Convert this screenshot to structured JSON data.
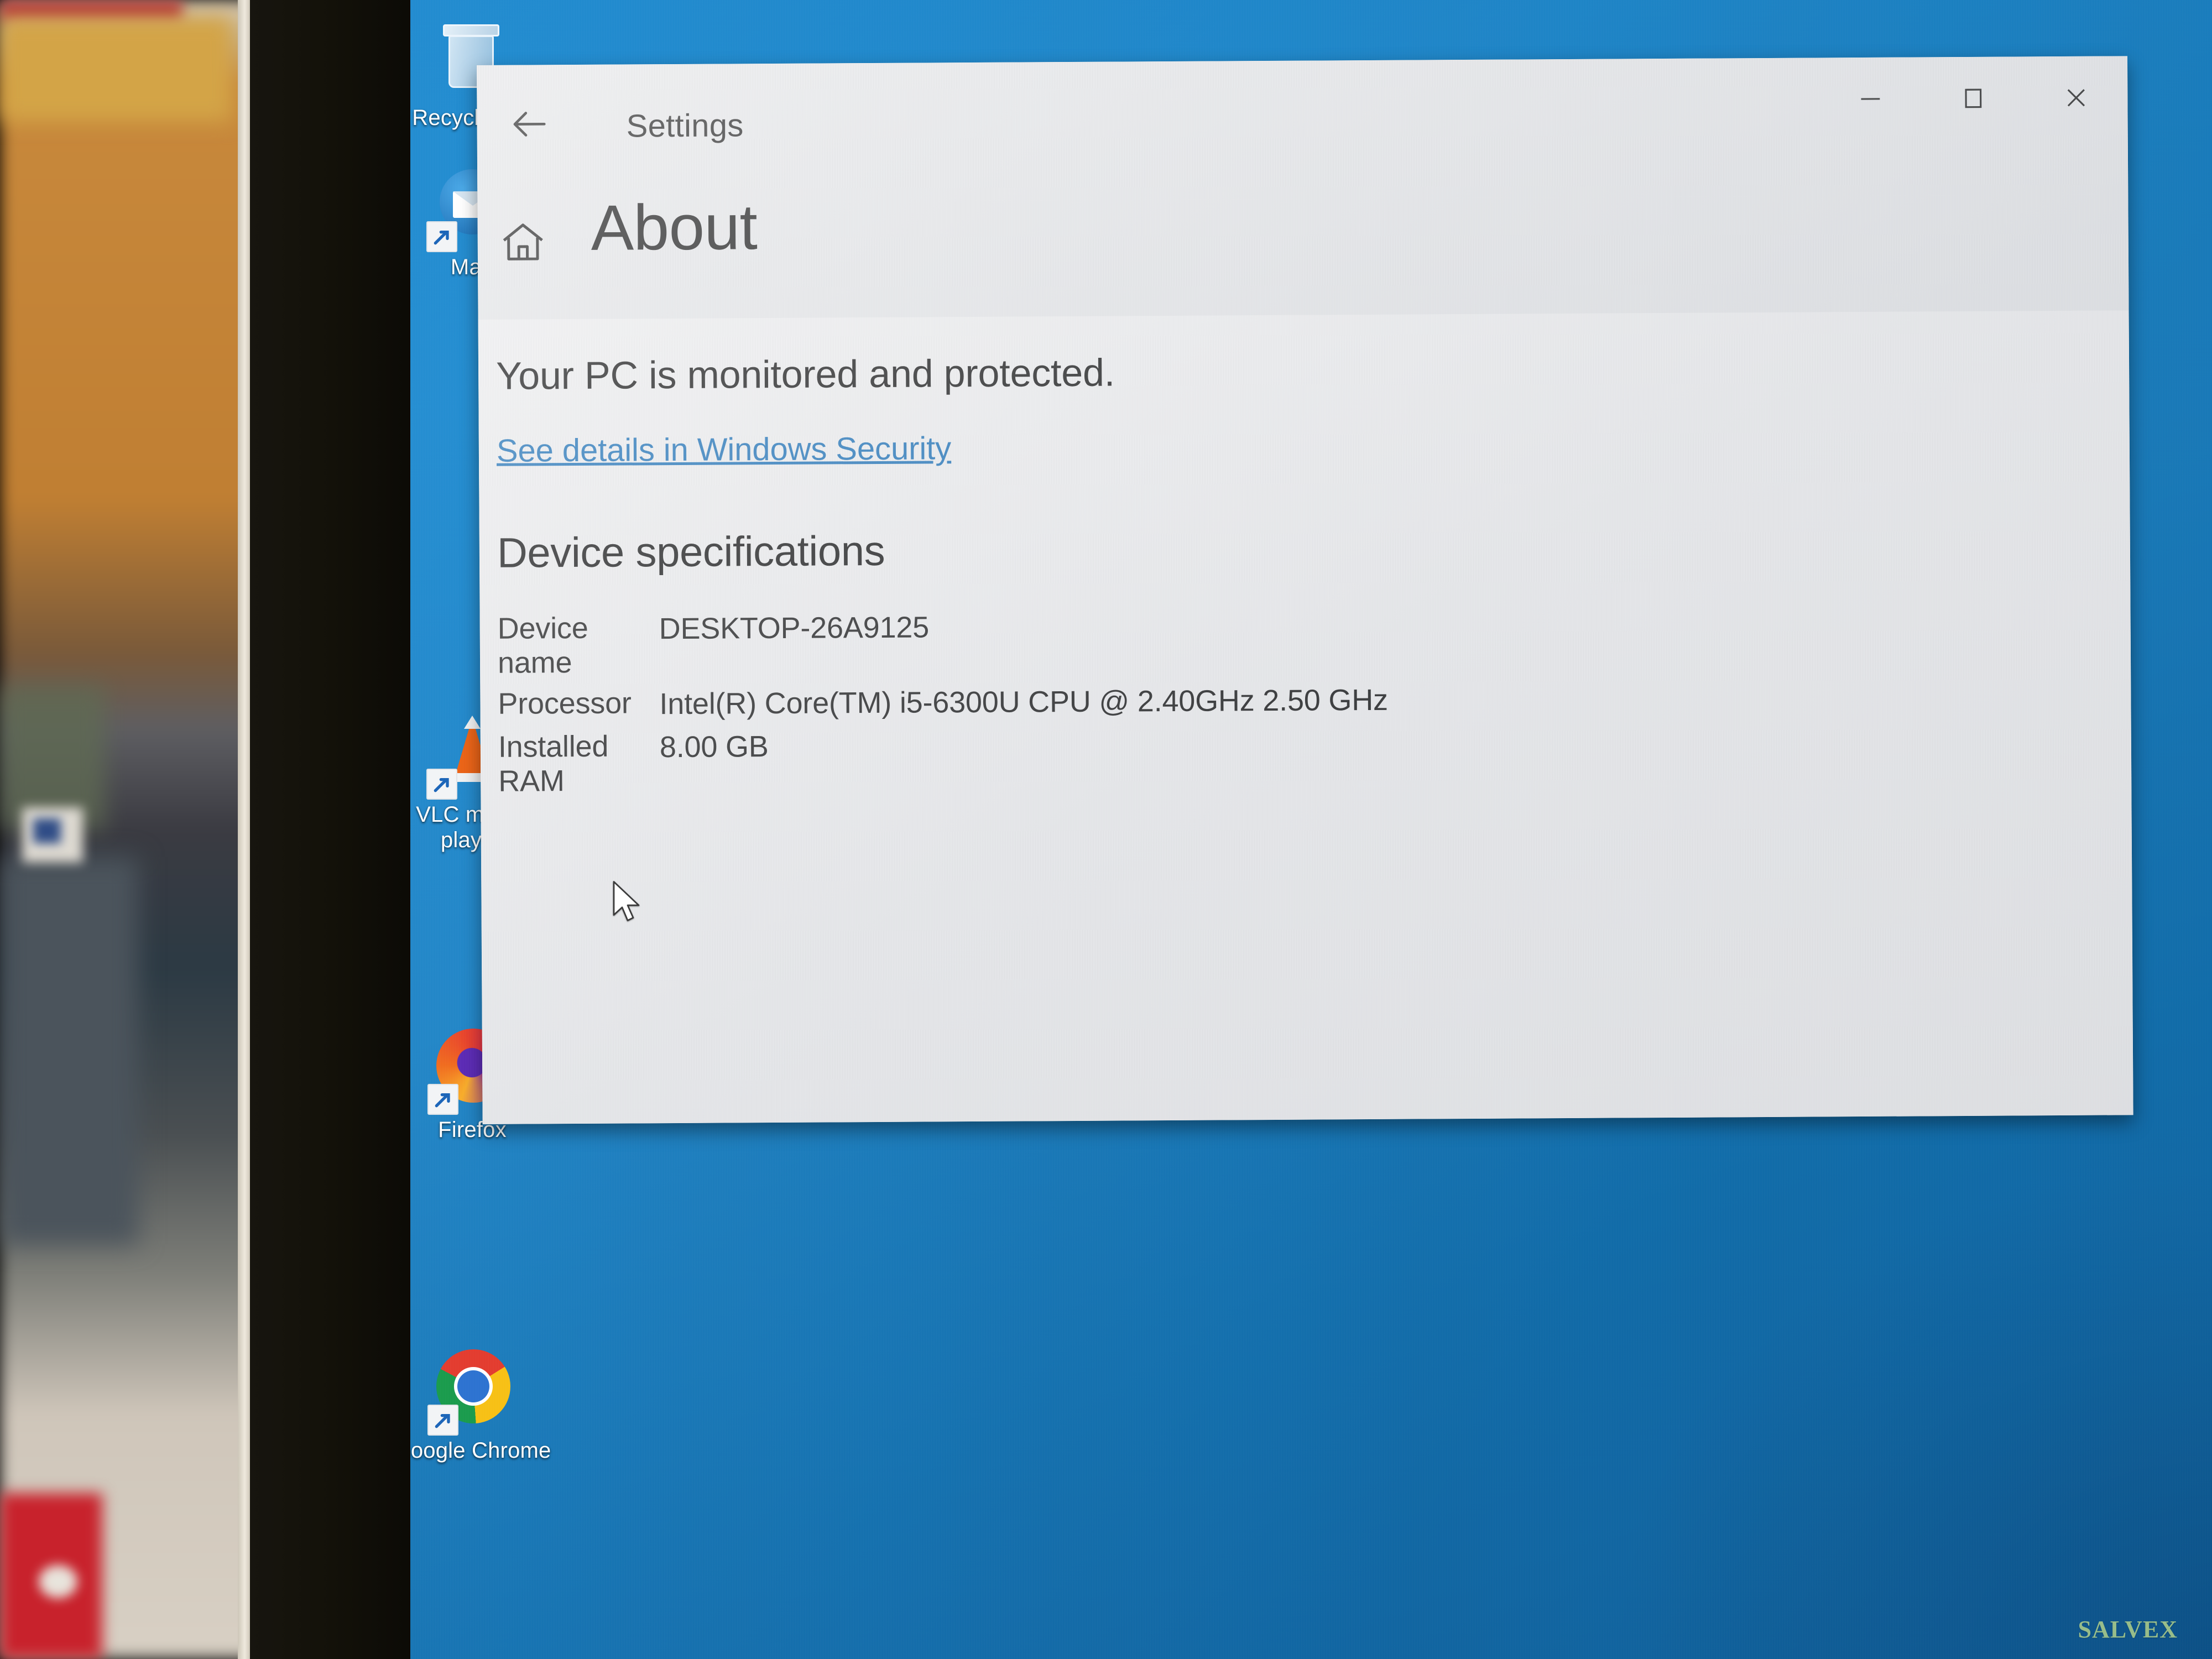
{
  "window": {
    "title": "Settings",
    "back_icon": "back-arrow-icon",
    "minimize_icon": "minimize-icon",
    "maximize_icon": "maximize-icon",
    "close_icon": "close-icon"
  },
  "page": {
    "home_icon": "home-icon",
    "title": "About",
    "status_text": "Your PC is monitored and protected.",
    "security_link": "See details in Windows Security",
    "section_heading": "Device specifications",
    "specs": [
      {
        "key": "Device name",
        "value": "DESKTOP-26A9125"
      },
      {
        "key": "Processor",
        "value": "Intel(R) Core(TM) i5-6300U CPU @ 2.40GHz   2.50 GHz"
      },
      {
        "key": "Installed RAM",
        "value": "8.00 GB"
      }
    ]
  },
  "desktop": {
    "icons": [
      {
        "name": "Recycle Bin",
        "icon": "recycle-bin-icon"
      },
      {
        "name": "Mail",
        "icon": "mail-icon"
      },
      {
        "name": "VLC media player",
        "icon": "vlc-cone-icon"
      },
      {
        "name": "Firefox",
        "icon": "firefox-icon"
      },
      {
        "name": "Google Chrome",
        "icon": "chrome-icon"
      }
    ]
  },
  "watermark": {
    "text": "SALVEX"
  },
  "colors": {
    "desktop_blue": "#1a86cc",
    "window_bg": "#f1f1f2",
    "titlebar_bg": "#e7e8ea",
    "link_blue": "#1970b8",
    "watermark_green": "#9ec289",
    "text_dark": "#141414"
  }
}
